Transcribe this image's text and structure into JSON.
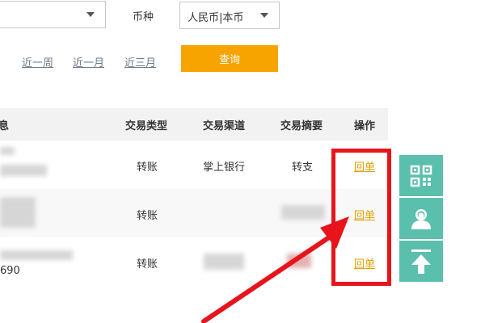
{
  "filters": {
    "account_select_value": "",
    "currency_label": "币种",
    "currency_value": "人民币|本币",
    "date_shortcuts": [
      "近一周",
      "近一月",
      "近三月"
    ],
    "query_label": "查询"
  },
  "table": {
    "headers": [
      "息",
      "交易类型",
      "交易渠道",
      "交易摘要",
      "操作"
    ],
    "rows": [
      {
        "info": "",
        "info_extra": "",
        "type": "转账",
        "channel": "掌上银行",
        "summary": "转支",
        "action": "回单"
      },
      {
        "info": "",
        "info_extra": "",
        "type": "转账",
        "channel": "",
        "summary": "",
        "action": "回单"
      },
      {
        "info": "",
        "info_extra": "690",
        "type": "转账",
        "channel": "",
        "summary": "",
        "action": "回单"
      }
    ]
  },
  "side_toolbar": {
    "items": [
      "qr-code-icon",
      "customer-service-icon",
      "back-to-top-icon"
    ],
    "color": "#5bbfae"
  },
  "colors": {
    "accent": "#f7a300",
    "link": "#e2a100",
    "annotation": "#e8141c"
  }
}
